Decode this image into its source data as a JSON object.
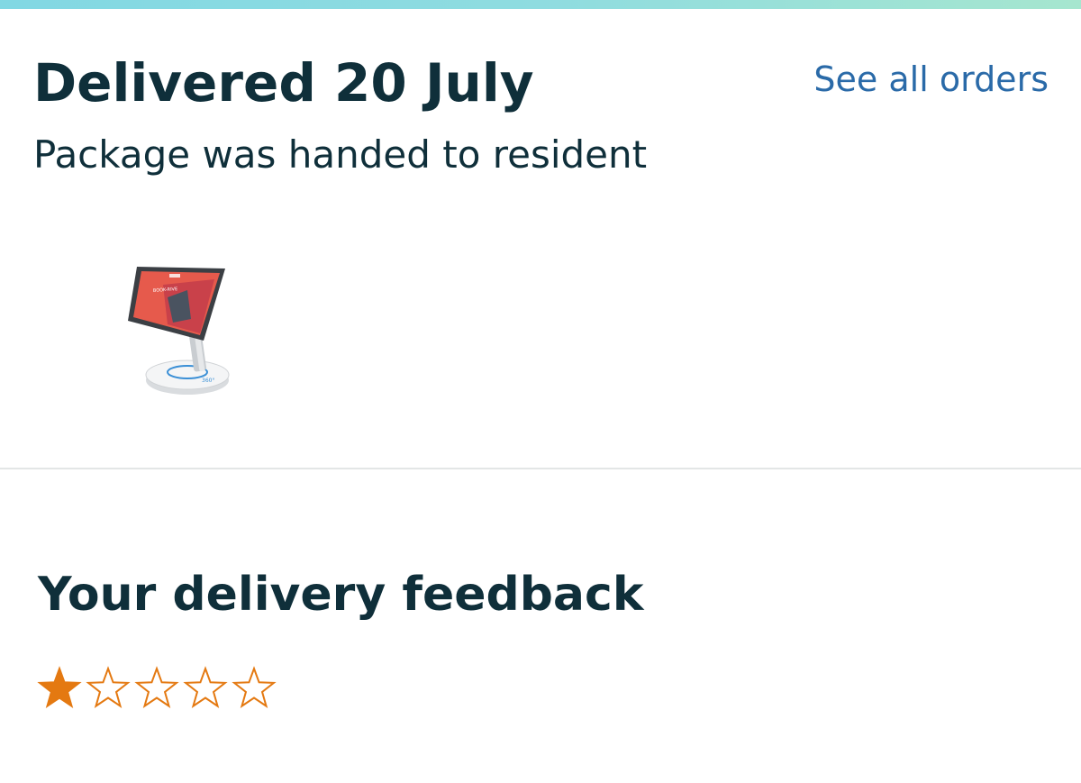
{
  "delivery": {
    "title": "Delivered 20 July",
    "status": "Package was handed to resident",
    "see_all_label": "See all orders"
  },
  "product": {
    "image_icon": "tablet-stand-product-image"
  },
  "feedback": {
    "title": "Your delivery feedback",
    "rating": 1,
    "max_rating": 5,
    "star_color": "#e47911"
  },
  "colors": {
    "heading": "#0f2f3a",
    "link": "#2a6aa8",
    "divider": "#e3e6e6"
  }
}
